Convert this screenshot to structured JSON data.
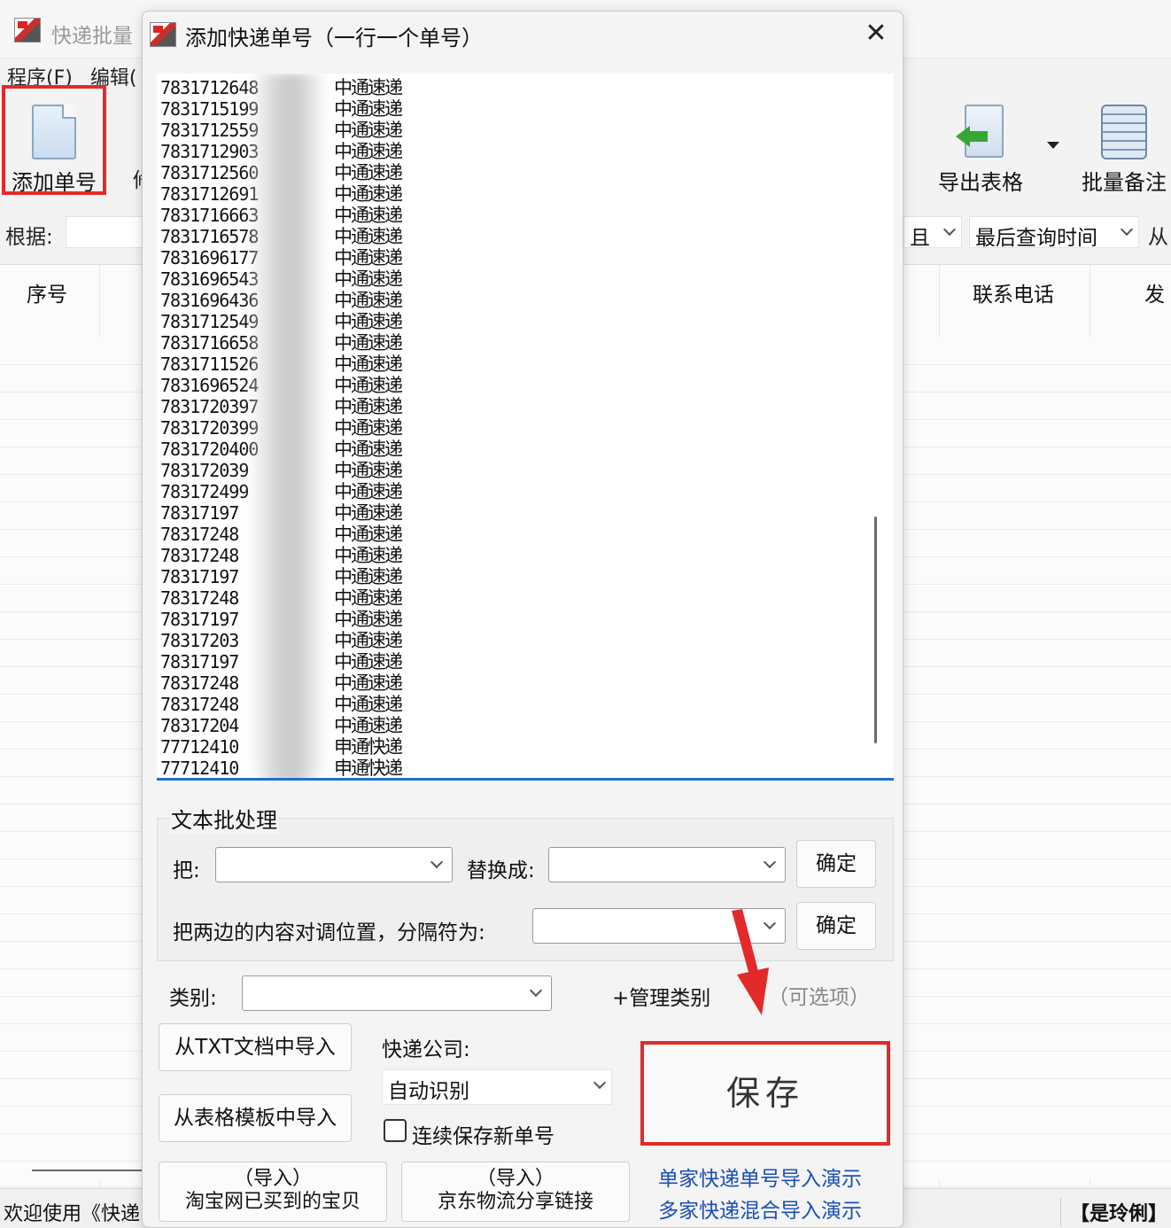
{
  "main_window": {
    "title": "快递批量",
    "menu": [
      "程序(F)",
      "编辑("
    ],
    "toolbar": {
      "add_label": "添加单号",
      "partial_char": "修",
      "export_label": "导出表格",
      "note_label": "批量备注"
    },
    "filter": {
      "basis_label": "根据:",
      "combo_partial": "且",
      "sort_value": "最后查询时间",
      "from_label": "从"
    },
    "columns": [
      "序号",
      "联系电话",
      "发"
    ],
    "status_left": "欢迎使用《快递",
    "status_right": "【是玲俐】"
  },
  "dialog": {
    "title": "添加快递单号（一行一个单号）",
    "close_glyph": "✕",
    "tracking_rows": [
      {
        "num": "7831712648",
        "carrier": "中通速递"
      },
      {
        "num": "7831715199",
        "carrier": "中通速递"
      },
      {
        "num": "7831712559",
        "carrier": "中通速递"
      },
      {
        "num": "7831712903",
        "carrier": "中通速递"
      },
      {
        "num": "7831712560",
        "carrier": "中通速递"
      },
      {
        "num": "7831712691",
        "carrier": "中通速递"
      },
      {
        "num": "7831716663",
        "carrier": "中通速递"
      },
      {
        "num": "7831716578",
        "carrier": "中通速递"
      },
      {
        "num": "7831696177",
        "carrier": "中通速递"
      },
      {
        "num": "7831696543",
        "carrier": "中通速递"
      },
      {
        "num": "7831696436",
        "carrier": "中通速递"
      },
      {
        "num": "7831712549",
        "carrier": "中通速递"
      },
      {
        "num": "7831716658",
        "carrier": "中通速递"
      },
      {
        "num": "7831711526",
        "carrier": "中通速递"
      },
      {
        "num": "7831696524",
        "carrier": "中通速递"
      },
      {
        "num": "7831720397",
        "carrier": "中通速递"
      },
      {
        "num": "7831720399",
        "carrier": "中通速递"
      },
      {
        "num": "7831720400",
        "carrier": "中通速递"
      },
      {
        "num": "783172039",
        "carrier": "中通速递"
      },
      {
        "num": "783172499",
        "carrier": "中通速递"
      },
      {
        "num": "78317197",
        "carrier": "中通速递"
      },
      {
        "num": "78317248",
        "carrier": "中通速递"
      },
      {
        "num": "78317248",
        "carrier": "中通速递"
      },
      {
        "num": "78317197",
        "carrier": "中通速递"
      },
      {
        "num": "78317248",
        "carrier": "中通速递"
      },
      {
        "num": "78317197",
        "carrier": "中通速递"
      },
      {
        "num": "78317203",
        "carrier": "中通速递"
      },
      {
        "num": "78317197",
        "carrier": "中通速递"
      },
      {
        "num": "78317248",
        "carrier": "中通速递"
      },
      {
        "num": "78317248",
        "carrier": "中通速递"
      },
      {
        "num": "78317204",
        "carrier": "中通速递"
      },
      {
        "num": "77712410",
        "carrier": "申通快递"
      },
      {
        "num": "77712410",
        "carrier": "申通快递"
      }
    ],
    "batch": {
      "group_title": "文本批处理",
      "from_label": "把:",
      "from_value": "",
      "replace_label": "替换成:",
      "replace_value": "",
      "confirm1": "确定",
      "swap_label": "把两边的内容对调位置，分隔符为:",
      "separator_value": "",
      "confirm2": "确定"
    },
    "category_label": "类别:",
    "category_value": "",
    "manage_category": "+管理类别",
    "optional_hint": "（可选项）",
    "import_txt": "从TXT文档中导入",
    "import_template": "从表格模板中导入",
    "import_taobao_line1": "（导入）",
    "import_taobao_line2": "淘宝网已买到的宝贝",
    "import_jd_line1": "（导入）",
    "import_jd_line2": "京东物流分享链接",
    "courier_label": "快递公司:",
    "courier_value": "自动识别",
    "continuous_save_label": "连续保存新单号",
    "continuous_save_checked": false,
    "save_label": "保存",
    "demo_single": "单家快递单号导入演示",
    "demo_multi": "多家快递混合导入演示"
  },
  "colors": {
    "highlight_red": "#e32a2a",
    "link_blue": "#1a4fb8",
    "focus_blue": "#1f6fc5"
  }
}
